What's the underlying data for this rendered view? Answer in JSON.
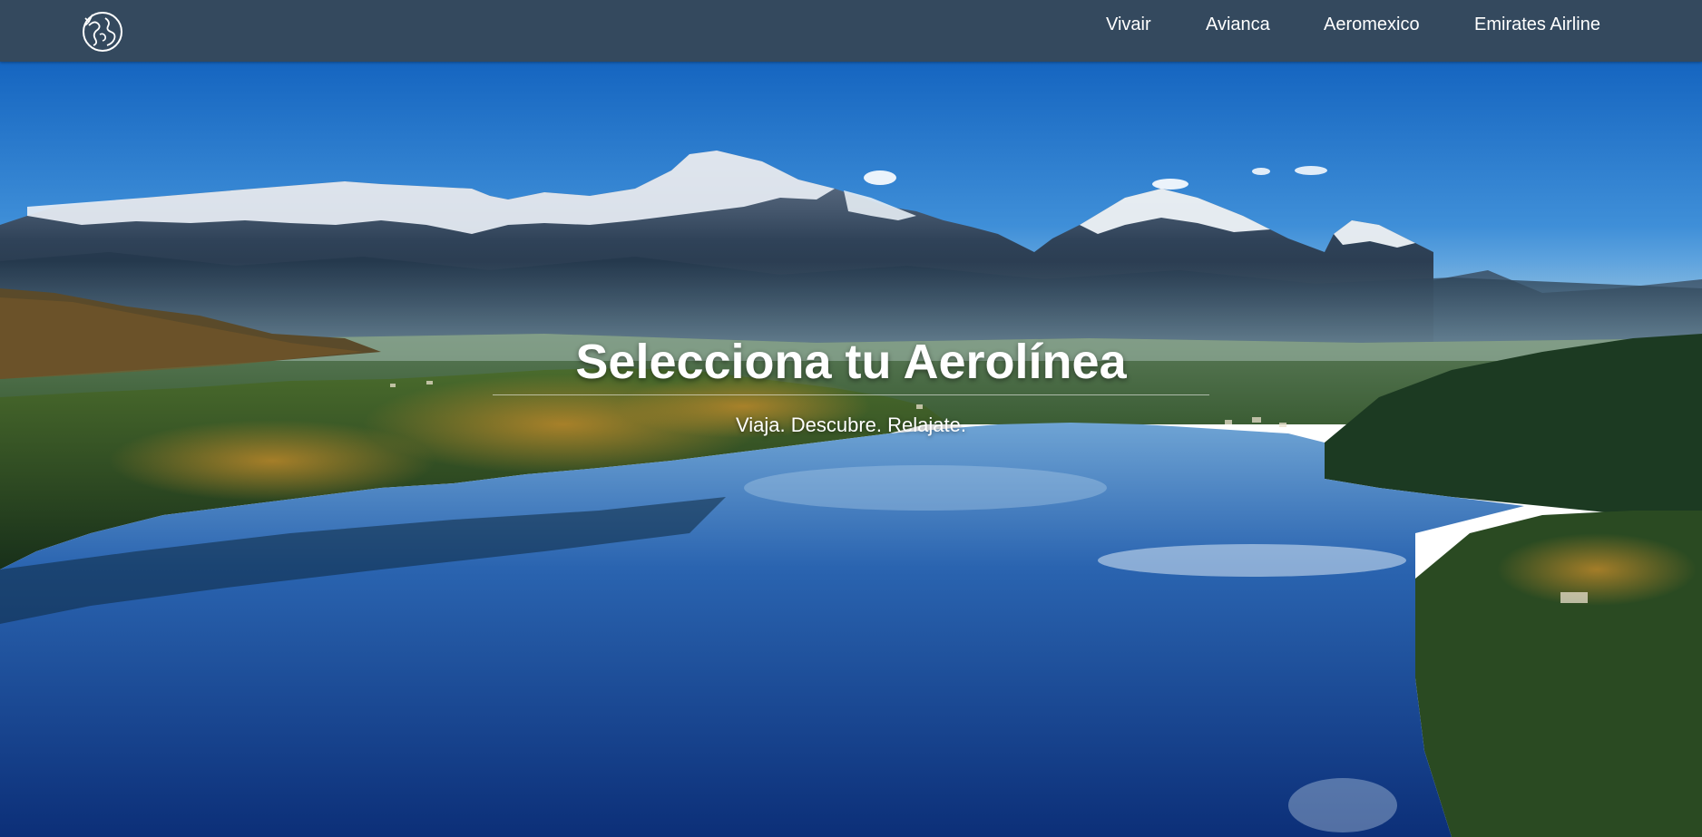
{
  "navbar": {
    "logo_icon": "globe-icon",
    "links": [
      {
        "label": "Vivair"
      },
      {
        "label": "Avianca"
      },
      {
        "label": "Aeromexico"
      },
      {
        "label": "Emirates Airline"
      }
    ],
    "background_color": "#34495e"
  },
  "hero": {
    "title": "Selecciona tu Aerolínea",
    "subtitle": "Viaja. Descubre. Relajate.",
    "background": "mountain-lake-landscape"
  }
}
